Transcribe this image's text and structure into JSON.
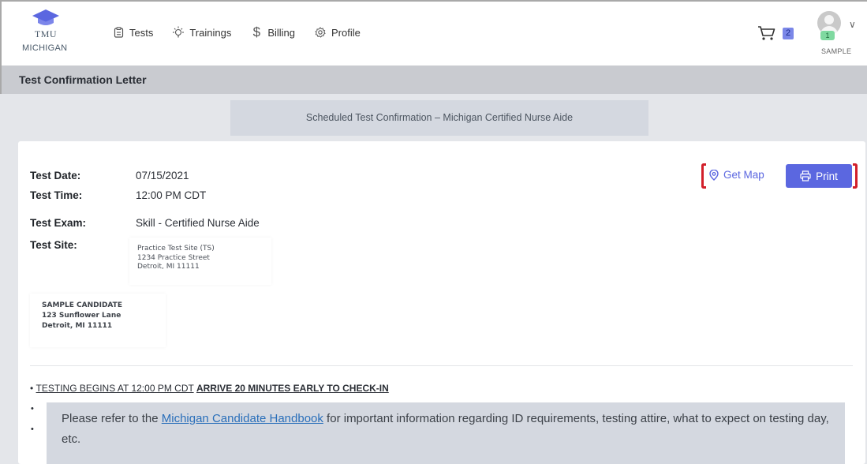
{
  "brand": {
    "line1": "TMU",
    "line2": "MICHIGAN",
    "accent": "#5b67e0"
  },
  "nav": [
    {
      "label": "Tests",
      "icon": "clipboard-icon"
    },
    {
      "label": "Trainings",
      "icon": "lightbulb-icon"
    },
    {
      "label": "Billing",
      "icon": "dollar-icon"
    },
    {
      "label": "Profile",
      "icon": "gear-icon"
    }
  ],
  "cart": {
    "count": "2",
    "icon": "cart-icon"
  },
  "account": {
    "notifications": "1",
    "name": "SAMPLE"
  },
  "page_title": "Test Confirmation Letter",
  "banner": "Scheduled Test Confirmation – Michigan Certified Nurse Aide",
  "details": {
    "date_label": "Test Date:",
    "date": "07/15/2021",
    "time_label": "Test Time:",
    "time": "12:00 PM CDT",
    "exam_label": "Test Exam:",
    "exam": "Skill - Certified Nurse Aide",
    "site_label": "Test Site:"
  },
  "site_address": [
    "Practice Test Site (TS)",
    "1234 Practice Street",
    "Detroit, MI 11111"
  ],
  "candidate_address": [
    "SAMPLE CANDIDATE",
    "123 Sunflower Lane",
    "Detroit, MI 11111"
  ],
  "actions": {
    "map_label": "Get Map",
    "print_label": "Print"
  },
  "instructions": {
    "begins": "TESTING BEGINS AT 12:00 PM CDT",
    "arrive": "ARRIVE 20 MINUTES EARLY TO CHECK-IN",
    "notice_before": "Please refer to the ",
    "notice_link": "Michigan Candidate Handbook",
    "notice_after": " for important information regarding ID requirements, testing attire, what to expect on testing day, etc."
  }
}
